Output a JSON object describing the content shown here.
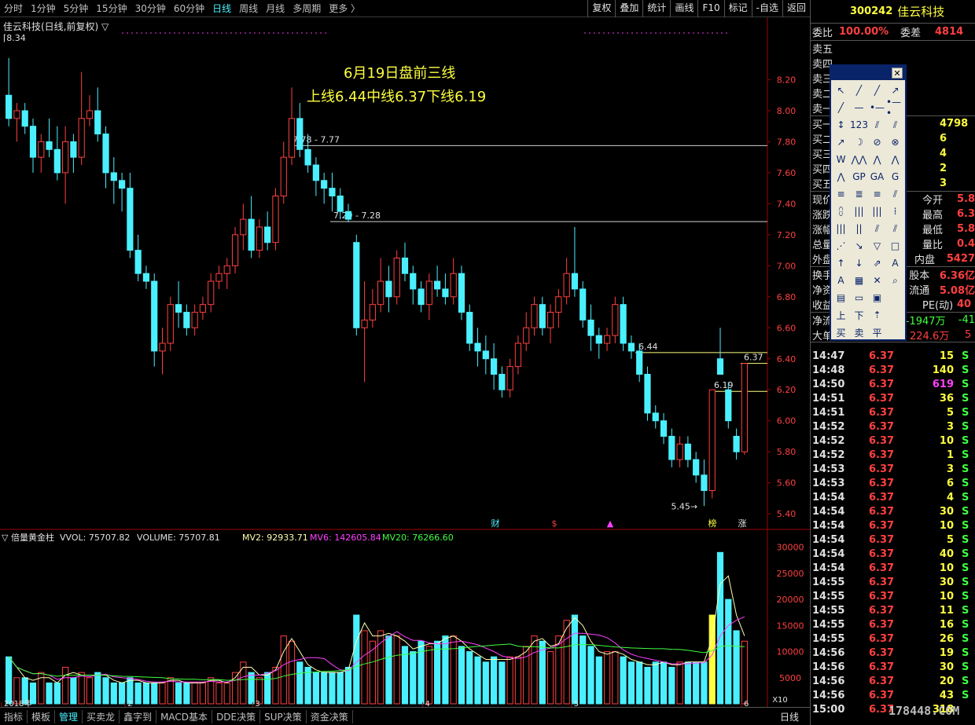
{
  "topbar": {
    "periods": [
      "分时",
      "1分钟",
      "5分钟",
      "15分钟",
      "30分钟",
      "60分钟",
      "日线",
      "周线",
      "月线",
      "多周期",
      "更多 〉"
    ],
    "active_index": 6,
    "tools": [
      "复权",
      "叠加",
      "统计",
      "画线",
      "F10",
      "标记",
      "-自选",
      "返回"
    ]
  },
  "chart": {
    "title": "佳云科技(日线,前复权) ▽",
    "high_label": "8.34",
    "annot_title": "6月19日盘前三线",
    "annot_sub": "上线6.44中线6.37下线6.19",
    "price_axis": [
      "8.20",
      "8.00",
      "7.80",
      "7.60",
      "7.40",
      "7.20",
      "7.00",
      "6.80",
      "6.60",
      "6.40",
      "6.20",
      "6.00",
      "5.80",
      "5.60",
      "5.40"
    ],
    "hlines": [
      {
        "label": "7.78 - 7.77",
        "value": 7.775
      },
      {
        "label": "7.29 - 7.28",
        "value": 7.285
      },
      {
        "label": "6.44",
        "value": 6.44
      },
      {
        "label": "6.37",
        "value": 6.37
      },
      {
        "label": "6.19",
        "value": 6.19
      }
    ],
    "low_label": "5.45",
    "event_markers": [
      "财",
      "$",
      "▲",
      "榜",
      "涨"
    ],
    "month_labels": [
      "2018年",
      "2",
      "3",
      "4",
      "5",
      "6"
    ],
    "volume_header": {
      "name": "▽ 倍量黄金柱",
      "vvol": "VVOL: 75707.82",
      "volume": "VOLUME: 75707.81",
      "mv2": "MV2: 92933.71",
      "mv6": "MV6: 142605.84",
      "mv20": "MV20: 76266.60"
    },
    "vol_axis": [
      "30000",
      "25000",
      "20000",
      "15000",
      "10000",
      "5000"
    ],
    "vol_unit": "X10"
  },
  "chart_data": {
    "type": "candlestick",
    "ylim": [
      5.35,
      8.4
    ],
    "candles": [
      [
        8.1,
        8.34,
        7.9,
        7.95
      ],
      [
        7.95,
        8.05,
        7.8,
        8.0
      ],
      [
        8.0,
        8.05,
        7.85,
        7.9
      ],
      [
        7.9,
        7.95,
        7.6,
        7.7
      ],
      [
        7.7,
        7.85,
        7.6,
        7.8
      ],
      [
        7.8,
        7.95,
        7.7,
        7.75
      ],
      [
        7.75,
        7.9,
        7.55,
        7.6
      ],
      [
        7.6,
        7.9,
        7.4,
        7.8
      ],
      [
        7.8,
        7.85,
        7.6,
        7.7
      ],
      [
        7.7,
        8.25,
        7.65,
        7.95
      ],
      [
        7.95,
        8.1,
        7.9,
        8.0
      ],
      [
        8.0,
        8.15,
        7.8,
        7.85
      ],
      [
        7.85,
        7.9,
        7.5,
        7.6
      ],
      [
        7.6,
        7.7,
        7.4,
        7.55
      ],
      [
        7.55,
        7.6,
        7.35,
        7.5
      ],
      [
        7.5,
        7.6,
        7.05,
        7.1
      ],
      [
        7.1,
        7.2,
        6.9,
        6.95
      ],
      [
        6.95,
        7.0,
        6.85,
        6.9
      ],
      [
        6.9,
        6.95,
        6.35,
        6.45
      ],
      [
        6.45,
        6.6,
        6.3,
        6.5
      ],
      [
        6.5,
        6.8,
        6.45,
        6.75
      ],
      [
        6.75,
        6.9,
        6.6,
        6.7
      ],
      [
        6.7,
        6.75,
        6.55,
        6.6
      ],
      [
        6.6,
        6.75,
        6.55,
        6.7
      ],
      [
        6.7,
        6.8,
        6.65,
        6.75
      ],
      [
        6.75,
        6.95,
        6.7,
        6.9
      ],
      [
        6.9,
        7.0,
        6.85,
        6.95
      ],
      [
        6.95,
        7.05,
        6.85,
        7.0
      ],
      [
        7.0,
        7.25,
        6.95,
        7.2
      ],
      [
        7.2,
        7.4,
        7.1,
        7.3
      ],
      [
        7.3,
        7.45,
        7.05,
        7.1
      ],
      [
        7.1,
        7.3,
        7.05,
        7.25
      ],
      [
        7.25,
        7.35,
        7.1,
        7.15
      ],
      [
        7.15,
        7.5,
        7.1,
        7.45
      ],
      [
        7.45,
        7.8,
        7.4,
        7.7
      ],
      [
        7.7,
        8.15,
        7.65,
        7.95
      ],
      [
        7.95,
        8.05,
        7.7,
        7.75
      ],
      [
        7.75,
        7.85,
        7.6,
        7.65
      ],
      [
        7.65,
        7.7,
        7.45,
        7.55
      ],
      [
        7.55,
        7.6,
        7.4,
        7.5
      ],
      [
        7.5,
        7.6,
        7.35,
        7.45
      ],
      [
        7.45,
        7.5,
        7.3,
        7.35
      ],
      [
        7.35,
        7.4,
        7.28,
        7.3
      ],
      [
        7.15,
        7.2,
        6.55,
        6.6
      ],
      [
        6.6,
        6.9,
        6.25,
        6.65
      ],
      [
        6.65,
        6.85,
        6.6,
        6.75
      ],
      [
        6.75,
        7.05,
        6.7,
        6.9
      ],
      [
        6.9,
        7.0,
        6.7,
        6.8
      ],
      [
        6.8,
        7.1,
        6.75,
        7.05
      ],
      [
        7.05,
        7.15,
        6.9,
        6.95
      ],
      [
        6.95,
        7.0,
        6.75,
        6.85
      ],
      [
        6.85,
        6.9,
        6.7,
        6.75
      ],
      [
        6.75,
        6.95,
        6.65,
        6.9
      ],
      [
        6.9,
        7.0,
        6.8,
        6.85
      ],
      [
        6.85,
        6.95,
        6.75,
        6.8
      ],
      [
        6.8,
        7.05,
        6.75,
        6.95
      ],
      [
        6.95,
        7.0,
        6.65,
        6.7
      ],
      [
        6.7,
        6.75,
        6.45,
        6.5
      ],
      [
        6.5,
        6.6,
        6.35,
        6.45
      ],
      [
        6.45,
        6.55,
        6.3,
        6.4
      ],
      [
        6.4,
        6.5,
        6.2,
        6.3
      ],
      [
        6.3,
        6.35,
        6.15,
        6.2
      ],
      [
        6.2,
        6.4,
        6.15,
        6.35
      ],
      [
        6.35,
        6.55,
        6.3,
        6.5
      ],
      [
        6.5,
        6.7,
        6.45,
        6.6
      ],
      [
        6.6,
        6.8,
        6.55,
        6.75
      ],
      [
        6.75,
        6.8,
        6.55,
        6.6
      ],
      [
        6.6,
        6.75,
        6.5,
        6.7
      ],
      [
        6.7,
        6.85,
        6.6,
        6.8
      ],
      [
        6.8,
        7.05,
        6.75,
        6.95
      ],
      [
        6.95,
        7.25,
        6.8,
        6.85
      ],
      [
        6.85,
        6.9,
        6.6,
        6.65
      ],
      [
        6.65,
        6.75,
        6.45,
        6.55
      ],
      [
        6.55,
        6.6,
        6.4,
        6.5
      ],
      [
        6.5,
        6.6,
        6.45,
        6.55
      ],
      [
        6.55,
        6.8,
        6.5,
        6.75
      ],
      [
        6.75,
        6.8,
        6.45,
        6.5
      ],
      [
        6.5,
        6.55,
        6.4,
        6.45
      ],
      [
        6.45,
        6.5,
        6.25,
        6.3
      ],
      [
        6.3,
        6.35,
        6.0,
        6.05
      ],
      [
        6.05,
        6.1,
        5.95,
        6.0
      ],
      [
        6.0,
        6.05,
        5.85,
        5.9
      ],
      [
        5.9,
        5.95,
        5.7,
        5.75
      ],
      [
        5.75,
        5.9,
        5.7,
        5.85
      ],
      [
        5.85,
        5.9,
        5.7,
        5.75
      ],
      [
        5.75,
        5.8,
        5.6,
        5.65
      ],
      [
        5.65,
        5.75,
        5.45,
        5.55
      ],
      [
        5.55,
        6.2,
        5.5,
        6.2
      ],
      [
        6.4,
        6.6,
        6.3,
        6.3
      ],
      [
        6.2,
        6.25,
        5.95,
        6.0
      ],
      [
        5.9,
        5.95,
        5.75,
        5.8
      ],
      [
        5.8,
        6.37,
        5.78,
        6.37
      ]
    ],
    "volumes": [
      9,
      5,
      5,
      4,
      6,
      4,
      4,
      7,
      5,
      6,
      5,
      6,
      5,
      4,
      4,
      5,
      4,
      4,
      4,
      4,
      5,
      4,
      4,
      4,
      4,
      5,
      4,
      4,
      6,
      8,
      6,
      5,
      6,
      7,
      13,
      12,
      8,
      7,
      6,
      6,
      6,
      6,
      7,
      17,
      14,
      12,
      14,
      13,
      13,
      11,
      10,
      12,
      11,
      12,
      13,
      13,
      11,
      10,
      9,
      8,
      9,
      8,
      9,
      9,
      11,
      13,
      12,
      10,
      13,
      16,
      17,
      13,
      11,
      9,
      10,
      10,
      9,
      8,
      8,
      7,
      8,
      8,
      7,
      8,
      8,
      8,
      8,
      17,
      29,
      20,
      14,
      12
    ],
    "volume_scale_max": 31000
  },
  "quote": {
    "code": "300242",
    "name": "佳云科技",
    "weibi_label": "委比",
    "weibi_value": "100.00%",
    "weicha_label": "委差",
    "weicha_value": "4814",
    "sell_labels": [
      "卖五",
      "卖四",
      "卖三",
      "卖二",
      "卖一"
    ],
    "buy_labels": [
      "买一",
      "买二",
      "买三",
      "买四",
      "买五"
    ],
    "buy_vols": [
      "4798",
      "6",
      "4",
      "2",
      "3"
    ],
    "stats": [
      {
        "l": "现价",
        "r_label": "今开",
        "r": "5.8"
      },
      {
        "l": "涨跌",
        "r_label": "最高",
        "r": "6.3"
      },
      {
        "l": "涨幅",
        "r_label": "最低",
        "r": "5.8"
      },
      {
        "l": "总量",
        "r_label": "量比",
        "r": "0.4"
      },
      {
        "l": "外盘",
        "r_label": "内盘",
        "r": "5427"
      }
    ],
    "stats2": [
      {
        "l": "换手",
        "r_label": "股本",
        "r": "6.36亿"
      },
      {
        "l": "净资",
        "r_label": "流通",
        "r": "5.08亿"
      },
      {
        "l": "收益",
        "r_label": "PE(动)",
        "r": "40"
      }
    ],
    "netflow_label": "净流",
    "netflow_value": "-1947万",
    "netflow_value2": "-41",
    "bigorder_label": "大单",
    "bigorder_value": "224.6万",
    "bigorder_value2": "5"
  },
  "ticks": [
    {
      "t": "14:47",
      "p": "6.37",
      "v": "15",
      "s": "S"
    },
    {
      "t": "14:48",
      "p": "6.37",
      "v": "140",
      "s": "S"
    },
    {
      "t": "14:50",
      "p": "6.37",
      "v": "619",
      "s": "S",
      "hl": true
    },
    {
      "t": "14:51",
      "p": "6.37",
      "v": "36",
      "s": "S"
    },
    {
      "t": "14:51",
      "p": "6.37",
      "v": "5",
      "s": "S"
    },
    {
      "t": "14:52",
      "p": "6.37",
      "v": "3",
      "s": "S"
    },
    {
      "t": "14:52",
      "p": "6.37",
      "v": "10",
      "s": "S"
    },
    {
      "t": "14:52",
      "p": "6.37",
      "v": "1",
      "s": "S"
    },
    {
      "t": "14:53",
      "p": "6.37",
      "v": "3",
      "s": "S"
    },
    {
      "t": "14:53",
      "p": "6.37",
      "v": "6",
      "s": "S"
    },
    {
      "t": "14:54",
      "p": "6.37",
      "v": "4",
      "s": "S"
    },
    {
      "t": "14:54",
      "p": "6.37",
      "v": "30",
      "s": "S"
    },
    {
      "t": "14:54",
      "p": "6.37",
      "v": "10",
      "s": "S"
    },
    {
      "t": "14:54",
      "p": "6.37",
      "v": "5",
      "s": "S"
    },
    {
      "t": "14:54",
      "p": "6.37",
      "v": "40",
      "s": "S"
    },
    {
      "t": "14:54",
      "p": "6.37",
      "v": "10",
      "s": "S"
    },
    {
      "t": "14:55",
      "p": "6.37",
      "v": "30",
      "s": "S"
    },
    {
      "t": "14:55",
      "p": "6.37",
      "v": "10",
      "s": "S"
    },
    {
      "t": "14:55",
      "p": "6.37",
      "v": "11",
      "s": "S"
    },
    {
      "t": "14:55",
      "p": "6.37",
      "v": "16",
      "s": "S"
    },
    {
      "t": "14:55",
      "p": "6.37",
      "v": "26",
      "s": "S"
    },
    {
      "t": "14:56",
      "p": "6.37",
      "v": "19",
      "s": "S"
    },
    {
      "t": "14:56",
      "p": "6.37",
      "v": "30",
      "s": "S"
    },
    {
      "t": "14:56",
      "p": "6.37",
      "v": "20",
      "s": "S"
    },
    {
      "t": "14:56",
      "p": "6.37",
      "v": "43",
      "s": "S"
    },
    {
      "t": "15:00",
      "p": "6.37",
      "v": "318",
      "s": ""
    }
  ],
  "draw_toolbar": {
    "cells": [
      "↖",
      "╱",
      "╱",
      "↗",
      "╱",
      "—",
      "•—",
      "•—•",
      "↕",
      "123",
      "⫽",
      "⫽",
      "↗",
      "☽",
      "⊘",
      "⊗",
      "W",
      "⋀⋀",
      "⋀",
      "⋀",
      "⋀",
      "GP",
      "GA",
      "G",
      "≡",
      "≣",
      "≡",
      "⫽",
      "⩉",
      "|||",
      "|||",
      "⁞",
      "|||",
      "||",
      "⫽",
      "⫽",
      "⋰",
      "↘",
      "▽",
      "□",
      "↑",
      "↓",
      "⇗",
      "A",
      "A",
      "▦",
      "✕",
      "⌕",
      "▤",
      "▭",
      "▣",
      "",
      "上",
      "下",
      "⇡",
      "",
      "买",
      "卖",
      "平",
      ""
    ],
    "close": "✕"
  },
  "bottom": {
    "tabs": [
      "指标",
      "模板",
      "管理",
      "买卖龙",
      "鑫字到",
      "MACD基本",
      "DDE决策",
      "SUP决策",
      "资金决策"
    ],
    "active_index": 2,
    "period_label": "日线"
  },
  "watermark": "178448.COM",
  "colors": {
    "up": "#ff4040",
    "down": "#4af0ff",
    "ma2": "#ffffb0",
    "ma6": "#ff40ff",
    "ma20": "#40ff40",
    "gold_bar": "#ffff40",
    "axis_text": "#ff4040"
  }
}
